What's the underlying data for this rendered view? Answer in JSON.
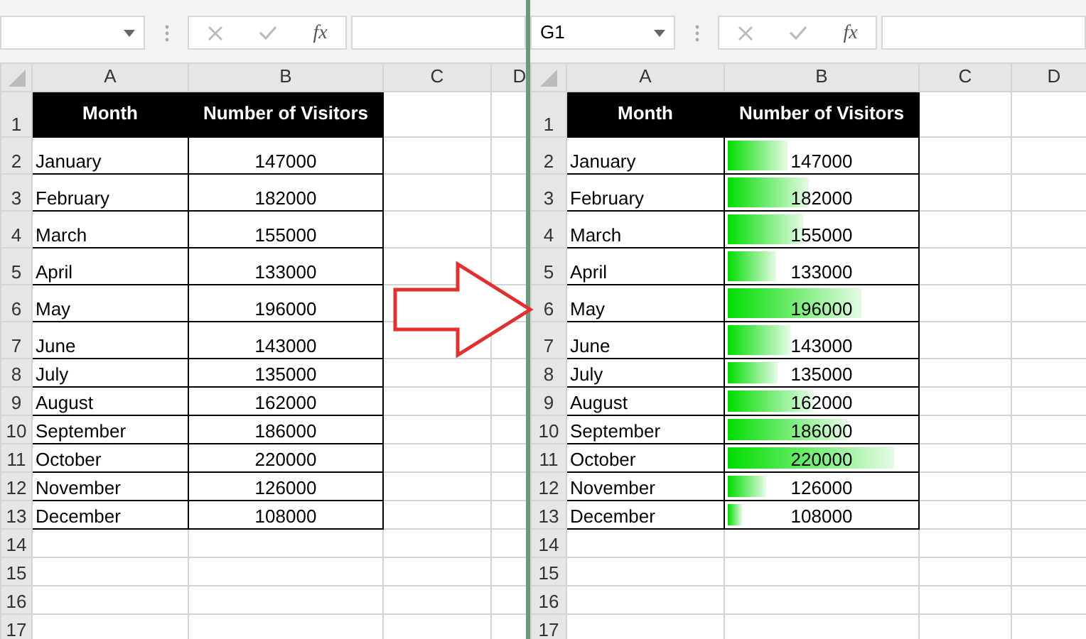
{
  "panes": [
    {
      "fx_label": "fx",
      "columns": [
        "A",
        "B",
        "C",
        "D"
      ],
      "row_numbers": [
        "1",
        "2",
        "3",
        "4",
        "5",
        "6",
        "7",
        "8",
        "9",
        "10",
        "11",
        "12",
        "13",
        "14",
        "15",
        "16",
        "17"
      ],
      "header": [
        "Month",
        "Number of Visitors"
      ],
      "rows": [
        {
          "month": "January",
          "visitors": "147000"
        },
        {
          "month": "February",
          "visitors": "182000"
        },
        {
          "month": "March",
          "visitors": "155000"
        },
        {
          "month": "April",
          "visitors": "133000"
        },
        {
          "month": "May",
          "visitors": "196000"
        },
        {
          "month": "June",
          "visitors": "143000"
        },
        {
          "month": "July",
          "visitors": "135000"
        },
        {
          "month": "August",
          "visitors": "162000"
        },
        {
          "month": "September",
          "visitors": "186000"
        },
        {
          "month": "October",
          "visitors": "220000"
        },
        {
          "month": "November",
          "visitors": "126000"
        },
        {
          "month": "December",
          "visitors": "108000"
        }
      ]
    },
    {
      "name_box": "G1",
      "fx_label": "fx",
      "columns": [
        "A",
        "B",
        "C",
        "D"
      ],
      "row_numbers": [
        "1",
        "2",
        "3",
        "4",
        "5",
        "6",
        "7",
        "8",
        "9",
        "10",
        "11",
        "12",
        "13",
        "14",
        "15",
        "16",
        "17"
      ],
      "header": [
        "Month",
        "Number of Visitors"
      ],
      "rows": [
        {
          "month": "January",
          "visitors": "147000",
          "level": 0.34
        },
        {
          "month": "February",
          "visitors": "182000",
          "level": 0.45
        },
        {
          "month": "March",
          "visitors": "155000",
          "level": 0.42
        },
        {
          "month": "April",
          "visitors": "133000",
          "level": 0.28
        },
        {
          "month": "May",
          "visitors": "196000",
          "level": 0.72
        },
        {
          "month": "June",
          "visitors": "143000",
          "level": 0.35
        },
        {
          "month": "July",
          "visitors": "135000",
          "level": 0.29
        },
        {
          "month": "August",
          "visitors": "162000",
          "level": 0.47
        },
        {
          "month": "September",
          "visitors": "186000",
          "level": 0.65
        },
        {
          "month": "October",
          "visitors": "220000",
          "level": 0.89
        },
        {
          "month": "November",
          "visitors": "126000",
          "level": 0.23
        },
        {
          "month": "December",
          "visitors": "108000",
          "level": 0.1
        }
      ]
    }
  ]
}
